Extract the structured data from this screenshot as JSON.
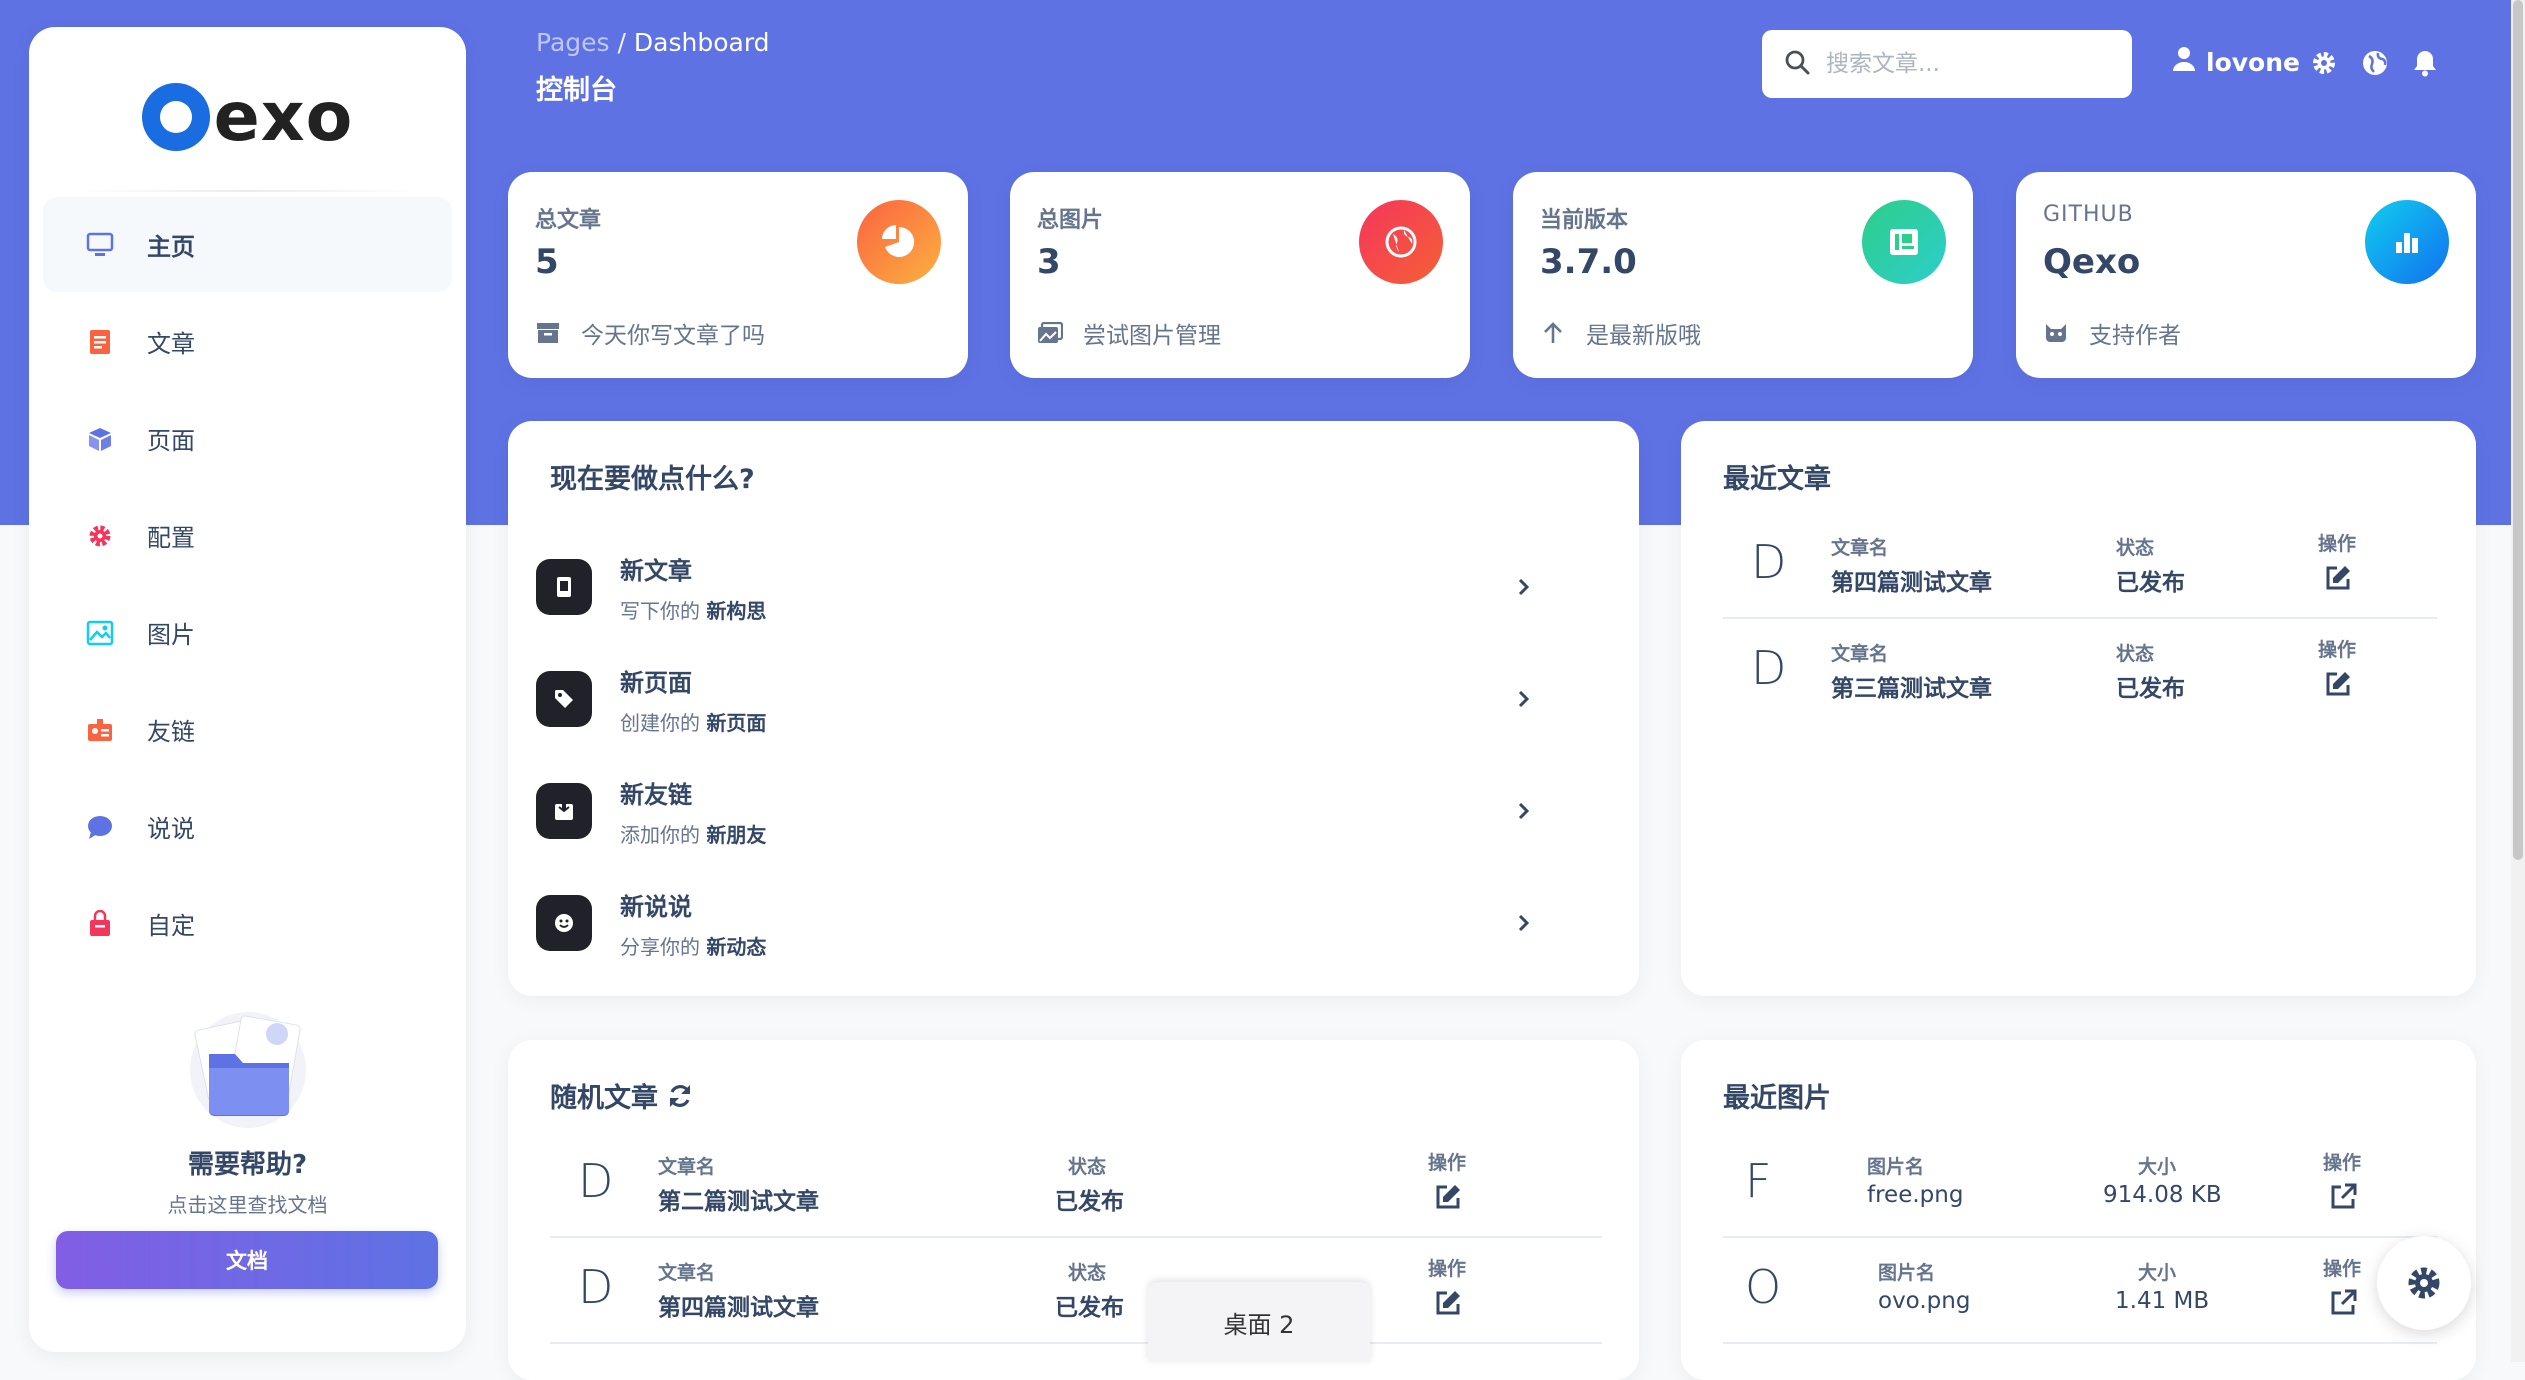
{
  "colors": {
    "primary": "#5e72e4",
    "orange": "#fb6340",
    "red": "#f5365c",
    "green": "#2dce89",
    "cyan": "#11cdef"
  },
  "sidebar": {
    "logo_text": "exo",
    "items": [
      {
        "label": "主页",
        "icon": "monitor-icon",
        "active": true
      },
      {
        "label": "文章",
        "icon": "document-icon"
      },
      {
        "label": "页面",
        "icon": "box-icon"
      },
      {
        "label": "配置",
        "icon": "gear-icon"
      },
      {
        "label": "图片",
        "icon": "image-icon"
      },
      {
        "label": "友链",
        "icon": "badge-icon"
      },
      {
        "label": "说说",
        "icon": "chat-bubble-icon"
      },
      {
        "label": "自定",
        "icon": "basket-icon"
      }
    ],
    "help_title": "需要帮助?",
    "help_sub": "点击这里查找文档",
    "doc_button": "文档"
  },
  "header": {
    "breadcrumb_root": "Pages",
    "breadcrumb_sep": "/",
    "breadcrumb_current": "Dashboard",
    "title": "控制台",
    "search_placeholder": "搜索文章...",
    "user": "lovone"
  },
  "stats": [
    {
      "label": "总文章",
      "value": "5",
      "foot": "今天你写文章了吗",
      "icon": "pie-chart-icon"
    },
    {
      "label": "总图片",
      "value": "3",
      "foot": "尝试图片管理",
      "icon": "world-icon"
    },
    {
      "label": "当前版本",
      "value": "3.7.0",
      "foot": "是最新版哦",
      "icon": "id-card-icon"
    },
    {
      "label": "GITHUB",
      "value": "Qexo",
      "foot": "支持作者",
      "icon": "bar-chart-icon"
    }
  ],
  "todo": {
    "title": "现在要做点什么?",
    "items": [
      {
        "title": "新文章",
        "sub_pre": "写下你的",
        "sub_bold": "新构思",
        "icon": "tablet-icon"
      },
      {
        "title": "新页面",
        "sub_pre": "创建你的",
        "sub_bold": "新页面",
        "icon": "tag-icon"
      },
      {
        "title": "新友链",
        "sub_pre": "添加你的",
        "sub_bold": "新朋友",
        "icon": "inbox-icon"
      },
      {
        "title": "新说说",
        "sub_pre": "分享你的",
        "sub_bold": "新动态",
        "icon": "smile-icon"
      }
    ]
  },
  "recent_posts": {
    "title": "最近文章",
    "rows": [
      {
        "letter": "D",
        "name_label": "文章名",
        "name": "第四篇测试文章",
        "status_label": "状态",
        "status": "已发布",
        "action_label": "操作"
      },
      {
        "letter": "D",
        "name_label": "文章名",
        "name": "第三篇测试文章",
        "status_label": "状态",
        "status": "已发布",
        "action_label": "操作"
      }
    ]
  },
  "random_posts": {
    "title": "随机文章",
    "rows": [
      {
        "letter": "D",
        "name_label": "文章名",
        "name": "第二篇测试文章",
        "status_label": "状态",
        "status": "已发布",
        "action_label": "操作"
      },
      {
        "letter": "D",
        "name_label": "文章名",
        "name": "第四篇测试文章",
        "status_label": "状态",
        "status": "已发布",
        "action_label": "操作"
      }
    ]
  },
  "recent_images": {
    "title": "最近图片",
    "rows": [
      {
        "letter": "F",
        "name_label": "图片名",
        "name": "free.png",
        "size_label": "大小",
        "size": "914.08 KB",
        "action_label": "操作"
      },
      {
        "letter": "O",
        "name_label": "图片名",
        "name": "ovo.png",
        "size_label": "大小",
        "size": "1.41 MB",
        "action_label": "操作"
      }
    ]
  },
  "taskbar_tooltip": "桌面 2"
}
